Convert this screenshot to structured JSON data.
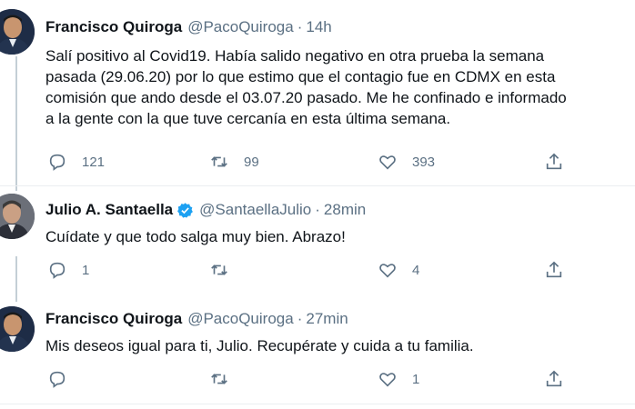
{
  "tweets": [
    {
      "name": "Francisco Quiroga",
      "handle": "@PacoQuiroga",
      "time": "14h",
      "text_lines": [
        "Salí positivo al Covid19. Había salido negativo en otra prueba la semana",
        "pasada (29.06.20) por lo que estimo que el contagio fue en CDMX en esta",
        "comisión que ando desde el 03.07.20 pasado. Me he confinado e informado",
        "a la gente con la que tuve cercanía en esta última semana."
      ],
      "replies": "121",
      "retweets": "99",
      "likes": "393",
      "verified": false
    },
    {
      "name": "Julio A. Santaella",
      "handle": "@SantaellaJulio",
      "time": "28min",
      "text_lines": [
        "Cuídate y que todo salga muy bien. Abrazo!"
      ],
      "replies": "1",
      "retweets": "",
      "likes": "4",
      "verified": true
    },
    {
      "name": "Francisco Quiroga",
      "handle": "@PacoQuiroga",
      "time": "27min",
      "text_lines": [
        "Mis deseos igual para ti, Julio. Recupérate y cuida a tu familia."
      ],
      "replies": "",
      "retweets": "",
      "likes": "1",
      "verified": false
    }
  ],
  "icons": {
    "reply": "reply-icon",
    "retweet": "retweet-icon",
    "like": "like-icon",
    "share": "share-icon",
    "verified": "verified-badge-icon"
  },
  "colors": {
    "text": "#0f1419",
    "secondary": "#5b7083",
    "verified": "#1da1f2",
    "thread_line": "#c4cfd6"
  }
}
